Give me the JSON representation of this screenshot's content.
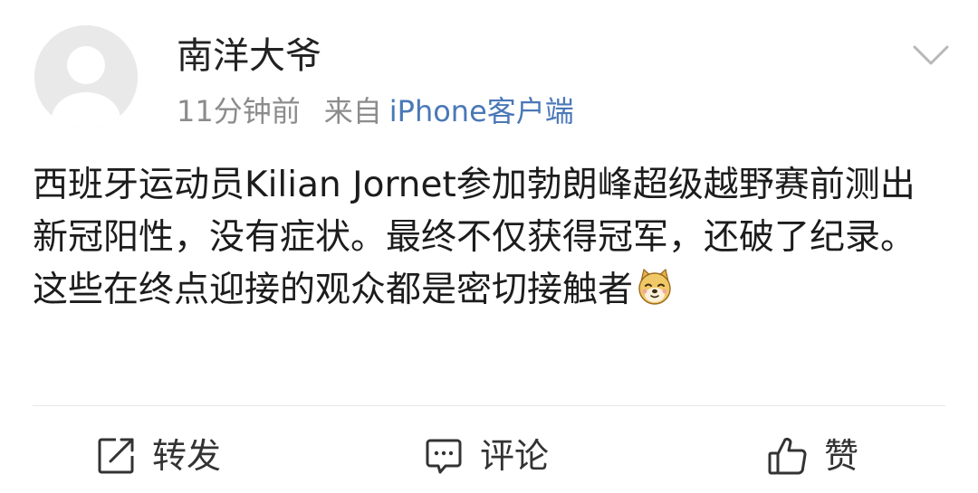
{
  "post": {
    "username": "南洋大爷",
    "time": "11分钟前",
    "from_label": "来自",
    "source": "iPhone客户端",
    "content": "西班牙运动员Kilian Jornet参加勃朗峰超级越野赛前测出新冠阳性，没有症状。最终不仅获得冠军，还破了纪录。这些在终点迎接的观众都是密切接触者",
    "emoji": "doge-emoji"
  },
  "actions": {
    "repost_label": "转发",
    "comment_label": "评论",
    "like_label": "赞"
  },
  "icons": {
    "avatar": "default-avatar-icon",
    "more": "chevron-down-icon",
    "repost": "repost-icon",
    "comment": "comment-icon",
    "like": "thumbs-up-icon"
  },
  "colors": {
    "source_link": "#4a78b8",
    "meta_text": "#8c8c8c",
    "divider": "#e6e6e6"
  }
}
